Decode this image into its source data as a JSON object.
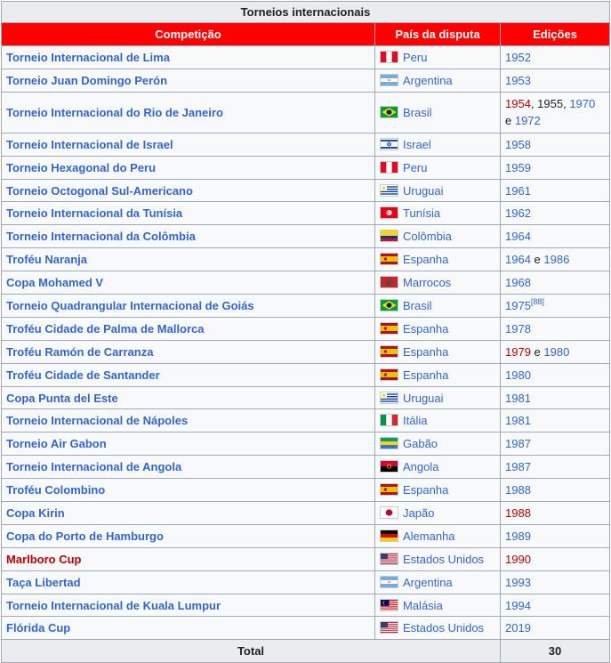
{
  "table": {
    "caption": "Torneios internacionais",
    "headers": [
      "Competição",
      "País da disputa",
      "Edições"
    ],
    "rows": [
      {
        "competition": "Torneio Internacional de Lima",
        "country": "Peru",
        "flag": "peru-flag",
        "editions": [
          {
            "t": "1952",
            "c": "link"
          }
        ]
      },
      {
        "competition": "Torneio Juan Domingo Perón",
        "country": "Argentina",
        "flag": "argentina-flag",
        "editions": [
          {
            "t": "1953",
            "c": "link"
          }
        ]
      },
      {
        "competition": "Torneio Internacional do Rio de Janeiro",
        "country": "Brasil",
        "flag": "brazil-flag",
        "editions": [
          {
            "t": "1954",
            "c": "red"
          },
          {
            "t": ", ",
            "c": "plain"
          },
          {
            "t": "1955",
            "c": "plain"
          },
          {
            "t": ", ",
            "c": "plain"
          },
          {
            "t": "1970",
            "c": "link"
          },
          {
            "t": " e ",
            "c": "plain"
          },
          {
            "t": "1972",
            "c": "link"
          }
        ]
      },
      {
        "competition": "Torneio Internacional de Israel",
        "country": "Israel",
        "flag": "israel-flag",
        "editions": [
          {
            "t": "1958",
            "c": "link"
          }
        ]
      },
      {
        "competition": "Torneio Hexagonal do Peru",
        "country": "Peru",
        "flag": "peru-flag",
        "editions": [
          {
            "t": "1959",
            "c": "link"
          }
        ]
      },
      {
        "competition": "Torneio Octogonal Sul-Americano",
        "country": "Uruguai",
        "flag": "uruguay-flag",
        "editions": [
          {
            "t": "1961",
            "c": "link"
          }
        ]
      },
      {
        "competition": "Torneio Internacional da Tunísia",
        "country": "Tunísia",
        "flag": "tunisia-flag",
        "editions": [
          {
            "t": "1962",
            "c": "link"
          }
        ]
      },
      {
        "competition": "Torneio Internacional da Colômbia",
        "country": "Colômbia",
        "flag": "colombia-flag",
        "editions": [
          {
            "t": "1964",
            "c": "link"
          }
        ]
      },
      {
        "competition": "Troféu Naranja",
        "country": "Espanha",
        "flag": "spain-flag",
        "editions": [
          {
            "t": "1964",
            "c": "link"
          },
          {
            "t": " e ",
            "c": "plain"
          },
          {
            "t": "1986",
            "c": "link"
          }
        ]
      },
      {
        "competition": "Copa Mohamed V",
        "country": "Marrocos",
        "flag": "morocco-flag",
        "editions": [
          {
            "t": "1968",
            "c": "link"
          }
        ]
      },
      {
        "competition": "Torneio Quadrangular Internacional de Goiás",
        "country": "Brasil",
        "flag": "brazil-flag",
        "editions": [
          {
            "t": "1975",
            "c": "link"
          },
          {
            "t": "[88]",
            "c": "sup"
          }
        ]
      },
      {
        "competition": "Troféu Cidade de Palma de Mallorca",
        "country": "Espanha",
        "flag": "spain-flag",
        "editions": [
          {
            "t": "1978",
            "c": "link"
          }
        ]
      },
      {
        "competition": "Troféu Ramón de Carranza",
        "country": "Espanha",
        "flag": "spain-flag",
        "editions": [
          {
            "t": "1979",
            "c": "red"
          },
          {
            "t": " e ",
            "c": "plain"
          },
          {
            "t": "1980",
            "c": "link"
          }
        ]
      },
      {
        "competition": "Troféu Cidade de Santander",
        "country": "Espanha",
        "flag": "spain-flag",
        "editions": [
          {
            "t": "1980",
            "c": "link"
          }
        ]
      },
      {
        "competition": "Copa Punta del Este",
        "country": "Uruguai",
        "flag": "uruguay-flag",
        "editions": [
          {
            "t": "1981",
            "c": "link"
          }
        ]
      },
      {
        "competition": "Torneio Internacional de Nápoles",
        "country": "Itália",
        "flag": "italy-flag",
        "editions": [
          {
            "t": "1981",
            "c": "link"
          }
        ]
      },
      {
        "competition": "Torneio Air Gabon",
        "country": "Gabão",
        "flag": "gabon-flag",
        "editions": [
          {
            "t": "1987",
            "c": "link"
          }
        ]
      },
      {
        "competition": "Torneio Internacional de Angola",
        "country": "Angola",
        "flag": "angola-flag",
        "editions": [
          {
            "t": "1987",
            "c": "link"
          }
        ]
      },
      {
        "competition": "Troféu Colombino",
        "country": "Espanha",
        "flag": "spain-flag",
        "editions": [
          {
            "t": "1988",
            "c": "link"
          }
        ]
      },
      {
        "competition": "Copa Kirin",
        "country": "Japão",
        "flag": "japan-flag",
        "editions": [
          {
            "t": "1988",
            "c": "red"
          }
        ]
      },
      {
        "competition": "Copa do Porto de Hamburgo",
        "country": "Alemanha",
        "flag": "germany-flag",
        "editions": [
          {
            "t": "1989",
            "c": "link"
          }
        ]
      },
      {
        "competition": "Marlboro Cup",
        "competition_color": "red",
        "country": "Estados Unidos",
        "flag": "usa-flag",
        "editions": [
          {
            "t": "1990",
            "c": "red"
          }
        ]
      },
      {
        "competition": "Taça Libertad",
        "country": "Argentina",
        "flag": "argentina-flag",
        "editions": [
          {
            "t": "1993",
            "c": "link"
          }
        ]
      },
      {
        "competition": "Torneio Internacional de Kuala Lumpur",
        "country": "Malásia",
        "flag": "malaysia-flag",
        "editions": [
          {
            "t": "1994",
            "c": "link"
          }
        ]
      },
      {
        "competition": "Flórida Cup",
        "country": "Estados Unidos",
        "flag": "usa-flag",
        "editions": [
          {
            "t": "2019",
            "c": "link"
          }
        ]
      }
    ],
    "total_label": "Total",
    "total_value": "30"
  },
  "colors": {
    "header_bg": "#ff0000",
    "link": "#3366cc",
    "redlink": "#ba0000",
    "cell_bg": "#f8f9fa",
    "caption_bg": "#eaecf0"
  }
}
